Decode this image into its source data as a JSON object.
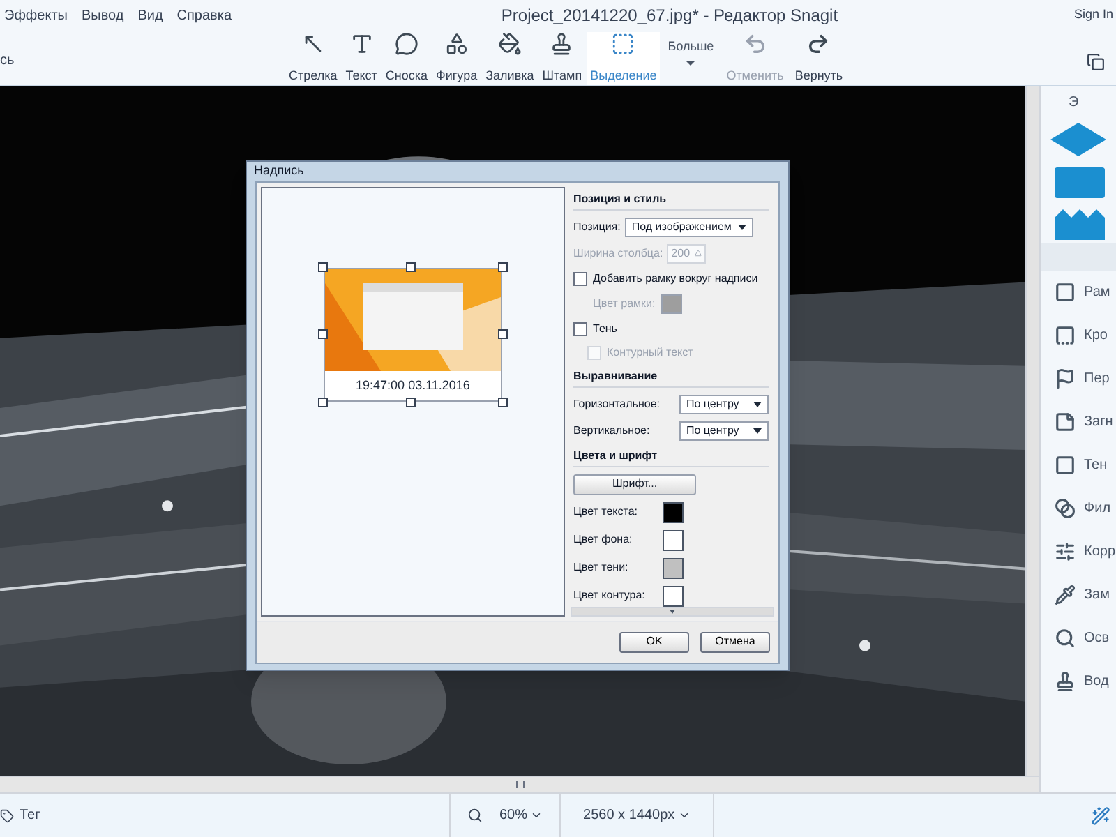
{
  "menu": [
    "Эффекты",
    "Вывод",
    "Вид",
    "Справка"
  ],
  "window_title": "Project_20141220_67.jpg* - Редактор Snagit",
  "sign_in": "Sign In",
  "left_label": "сь",
  "tools": [
    {
      "label": "Стрелка",
      "kind": "arrow",
      "selected": false
    },
    {
      "label": "Текст",
      "kind": "text",
      "selected": false
    },
    {
      "label": "Сноска",
      "kind": "callout",
      "selected": false
    },
    {
      "label": "Фигура",
      "kind": "shape",
      "selected": false
    },
    {
      "label": "Заливка",
      "kind": "fill",
      "selected": false
    },
    {
      "label": "Штамп",
      "kind": "stamp",
      "selected": false
    },
    {
      "label": "Выделение",
      "kind": "selection",
      "selected": true
    }
  ],
  "more": "Больше",
  "history": [
    {
      "label": "Отменить",
      "kind": "undo",
      "disabled": true
    },
    {
      "label": "Вернуть",
      "kind": "redo",
      "disabled": false
    }
  ],
  "dialog": {
    "title": "Надпись",
    "caption": "19:47:00 03.11.2016",
    "position_style": {
      "heading": "Позиция и стиль",
      "position_label": "Позиция:",
      "position_value": "Под изображением",
      "width_label": "Ширина столбца:",
      "width_value": "200",
      "width_disabled": true,
      "border": {
        "label": "Добавить рамку вокруг надписи",
        "checked": false
      },
      "border_color_label": "Цвет рамки:",
      "border_color_disabled": true,
      "shadow": {
        "label": "Тень",
        "checked": false
      },
      "outline_text": {
        "label": "Контурный текст",
        "checked": false,
        "disabled": true
      }
    },
    "alignment": {
      "heading": "Выравнивание",
      "rows": [
        {
          "label": "Горизонтальное:",
          "value": "По центру"
        },
        {
          "label": "Вертикальное:",
          "value": "По центру"
        }
      ]
    },
    "colors": {
      "heading": "Цвета и шрифт",
      "font_button": "Шрифт...",
      "swatches": [
        {
          "label": "Цвет текста:",
          "color": "#000000"
        },
        {
          "label": "Цвет фона:",
          "color": "#ffffff"
        },
        {
          "label": "Цвет тени:",
          "color": "#c0c0c0"
        },
        {
          "label": "Цвет контура:",
          "color": "#ffffff"
        }
      ]
    },
    "buttons": [
      "OK",
      "Отмена"
    ]
  },
  "effects_panel": {
    "header": "Э",
    "items": [
      {
        "label": "Рам",
        "kind": "border"
      },
      {
        "label": "Кро",
        "kind": "edge"
      },
      {
        "label": "Пер",
        "kind": "perspective"
      },
      {
        "label": "Загн",
        "kind": "curl"
      },
      {
        "label": "Тен",
        "kind": "shadow"
      },
      {
        "label": "Фил",
        "kind": "filter"
      },
      {
        "label": "Корр",
        "kind": "adjust"
      },
      {
        "label": "Зам",
        "kind": "replace"
      },
      {
        "label": "Осв",
        "kind": "spotlight"
      },
      {
        "label": "Вод",
        "kind": "watermark"
      }
    ]
  },
  "status_bar": {
    "tag": "Тег",
    "zoom": "60%",
    "dimensions": "2560 x 1440px"
  }
}
